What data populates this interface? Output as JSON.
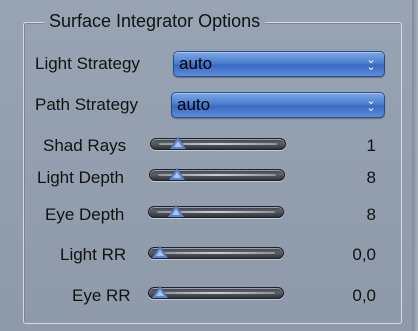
{
  "group": {
    "title": "Surface Integrator Options"
  },
  "light_strategy": {
    "label": "Light Strategy",
    "value": "auto",
    "icon": "double-chevron-down-icon"
  },
  "path_strategy": {
    "label": "Path Strategy",
    "value": "auto",
    "icon": "double-chevron-down-icon"
  },
  "sliders": [
    {
      "label": "Shad Rays",
      "value": "1"
    },
    {
      "label": "Light Depth",
      "value": "8"
    },
    {
      "label": "Eye Depth",
      "value": "8"
    },
    {
      "label": "Light RR",
      "value": "0,0"
    },
    {
      "label": "Eye RR",
      "value": "0,0"
    }
  ],
  "colors": {
    "background": "#8f9bab",
    "select_accent": "#4d7fcf",
    "slider_track": "#3c4047",
    "slider_thumb": "#5e84c8"
  }
}
